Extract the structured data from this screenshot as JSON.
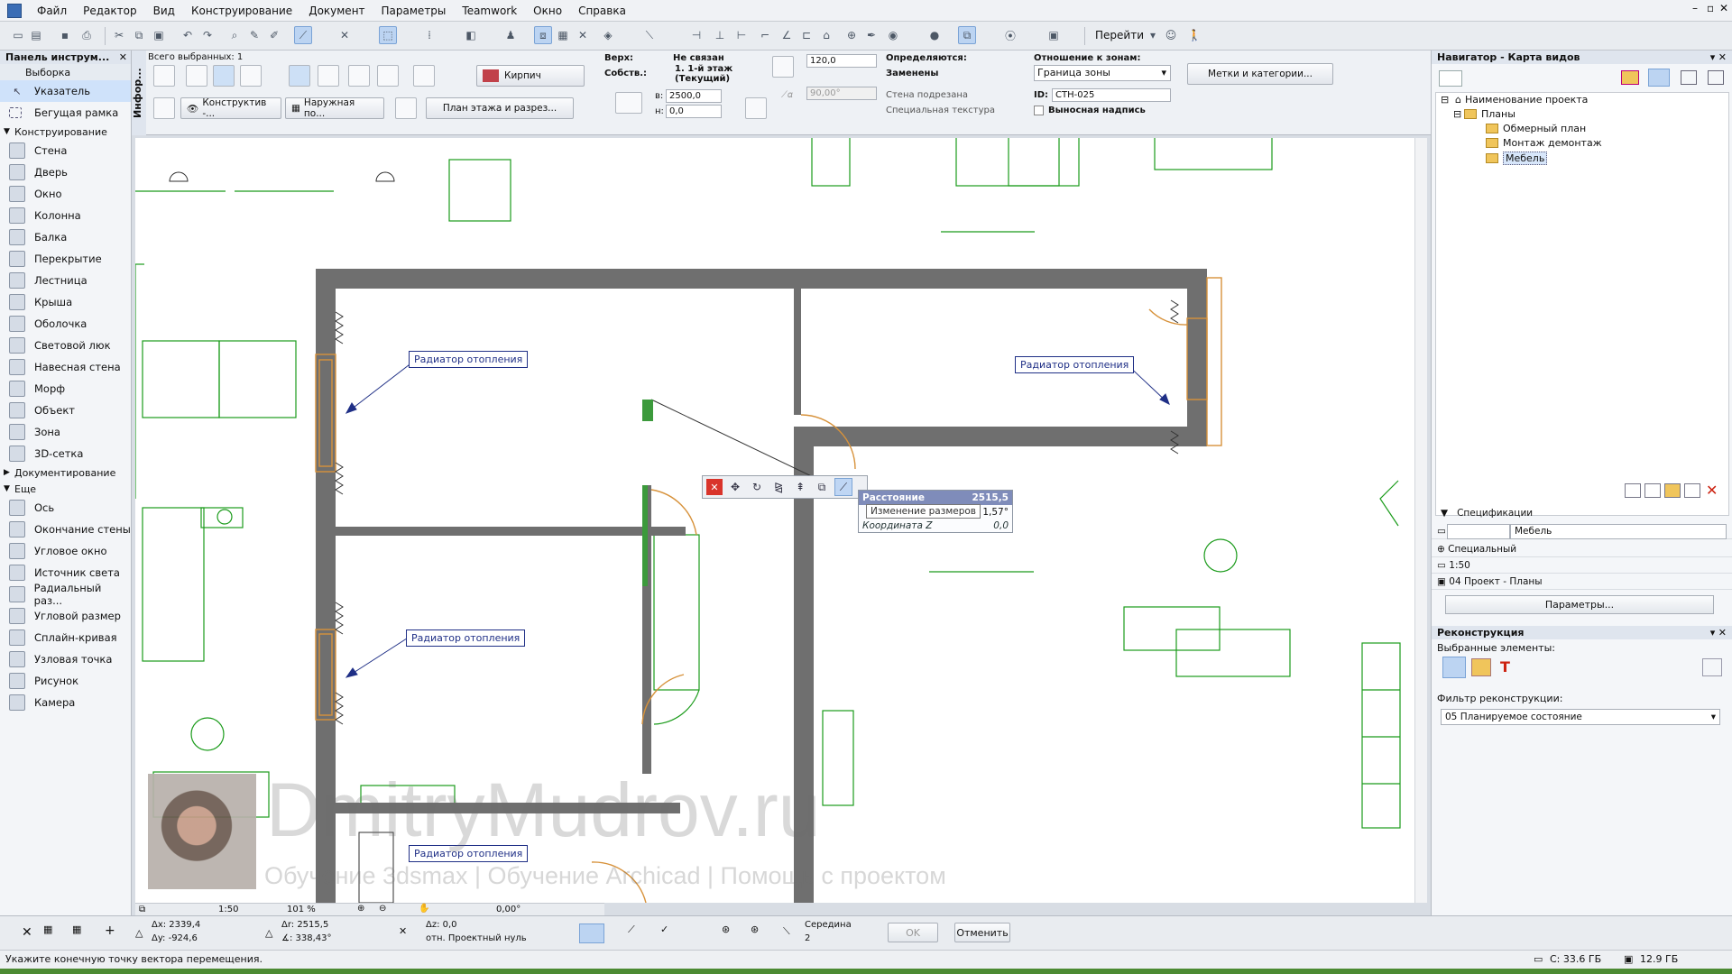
{
  "menu": [
    "Файл",
    "Редактор",
    "Вид",
    "Конструирование",
    "Документ",
    "Параметры",
    "Teamwork",
    "Окно",
    "Справка"
  ],
  "toolbar": {
    "goto_label": "Перейти"
  },
  "toolbox": {
    "title": "Панель инструм...",
    "section_select": "Выборка",
    "select_tools": [
      {
        "label": "Указатель",
        "icon": "pointer-icon"
      },
      {
        "label": "Бегущая рамка",
        "icon": "marquee-icon"
      }
    ],
    "group_construct": "Конструирование",
    "construct_tools": [
      {
        "label": "Стена",
        "icon": "wall-icon"
      },
      {
        "label": "Дверь",
        "icon": "door-icon"
      },
      {
        "label": "Окно",
        "icon": "window-icon"
      },
      {
        "label": "Колонна",
        "icon": "column-icon"
      },
      {
        "label": "Балка",
        "icon": "beam-icon"
      },
      {
        "label": "Перекрытие",
        "icon": "slab-icon"
      },
      {
        "label": "Лестница",
        "icon": "stair-icon"
      },
      {
        "label": "Крыша",
        "icon": "roof-icon"
      },
      {
        "label": "Оболочка",
        "icon": "shell-icon"
      },
      {
        "label": "Световой люк",
        "icon": "skylight-icon"
      },
      {
        "label": "Навесная стена",
        "icon": "curtain-wall-icon"
      },
      {
        "label": "Морф",
        "icon": "morph-icon"
      },
      {
        "label": "Объект",
        "icon": "object-icon"
      },
      {
        "label": "Зона",
        "icon": "zone-icon"
      },
      {
        "label": "3D-сетка",
        "icon": "mesh-icon"
      }
    ],
    "group_document": "Документирование",
    "group_more": "Еще",
    "more_tools": [
      {
        "label": "Ось",
        "icon": "grid-axis-icon"
      },
      {
        "label": "Окончание стены",
        "icon": "wall-end-icon"
      },
      {
        "label": "Угловое окно",
        "icon": "corner-window-icon"
      },
      {
        "label": "Источник света",
        "icon": "lamp-icon"
      },
      {
        "label": "Радиальный раз...",
        "icon": "radial-dimension-icon"
      },
      {
        "label": "Угловой размер",
        "icon": "angle-dimension-icon"
      },
      {
        "label": "Сплайн-кривая",
        "icon": "spline-icon"
      },
      {
        "label": "Узловая точка",
        "icon": "hotspot-icon"
      },
      {
        "label": "Рисунок",
        "icon": "figure-icon"
      },
      {
        "label": "Камера",
        "icon": "camera-icon"
      }
    ]
  },
  "infobox": {
    "title": "Инфор...",
    "selected_count": "Всего выбранных: 1",
    "brick_label": "Кирпич",
    "construct_label": "Конструктив -...",
    "outer_label": "Наружная по...",
    "plan_label": "План этажа и разрез...",
    "top_label": "Верх:",
    "top_value": "Не связан",
    "own_label": "Собств.:",
    "own_value": "1. 1-й этаж",
    "own_value2": "(Текущий)",
    "height_value": "120,0",
    "h_label": "в:",
    "h_value": "2500,0",
    "n_label": "н:",
    "n_value": "0,0",
    "angle_value": "90,00°",
    "defined_label": "Определяются:",
    "replaced_label": "Заменены",
    "wall_cut_label": "Стена подрезана",
    "special_texture_label": "Специальная текстура",
    "zone_rel_label": "Отношение к зонам:",
    "zone_rel_value": "Граница зоны",
    "id_label": "ID:",
    "id_value": "СТН-025",
    "callout_label": "Выносная надпись",
    "tags_button": "Метки и категории..."
  },
  "canvas": {
    "callouts": [
      "Радиатор отопления",
      "Радиатор отопления",
      "Радиатор отопления",
      "Радиатор отопления"
    ],
    "tracker": {
      "distance_label": "Расстояние",
      "distance_value": "2515,5",
      "angle_value": "1,57°",
      "z_label": "Координата Z",
      "z_value": "0,0"
    },
    "tooltip": "Изменение размеров",
    "watermark": "DmitryMudrov.ru",
    "watermark_sub": "Обучение 3dsmax | Обучение Archicad | Помощь с проектом"
  },
  "viewbar": {
    "scale": "1:50",
    "zoom": "101 %",
    "angle": "0,00°"
  },
  "navigator": {
    "title": "Навигатор - Карта видов",
    "tree": [
      {
        "label": "Наименование проекта",
        "level": 0
      },
      {
        "label": "Планы",
        "level": 1
      },
      {
        "label": "Обмерный план",
        "level": 2
      },
      {
        "label": "Монтаж демонтаж",
        "level": 2
      },
      {
        "label": "Мебель",
        "level": 2
      }
    ],
    "specs_title": "Спецификации",
    "spec_name": "Мебель",
    "spec_special": "Специальный",
    "spec_scale": "1:50",
    "spec_project": "04 Проект - Планы",
    "params_button": "Параметры..."
  },
  "renovation": {
    "title": "Реконструкция",
    "selected_label": "Выбранные элементы:",
    "filter_label": "Фильтр реконструкции:",
    "filter_value": "05 Планируемое состояние"
  },
  "coordbar": {
    "dx": "Δx: 2339,4",
    "dy": "Δy: -924,6",
    "dr": "Δr: 2515,5",
    "da": "∡: 338,43°",
    "dz": "Δz: 0,0",
    "ref": "отн. Проектный нуль",
    "snap_label": "Середина",
    "snap_value": "2",
    "ok": "OK",
    "cancel": "Отменить"
  },
  "status": {
    "message": "Укажите конечную точку вектора перемещения.",
    "disk_c": "C: 33.6 ГБ",
    "disk_other": "12.9 ГБ"
  },
  "colors": {
    "wall": "#6f6f6f",
    "furniture": "#1a9b1a",
    "callout": "#1f2f86",
    "window": "#d7923b"
  }
}
